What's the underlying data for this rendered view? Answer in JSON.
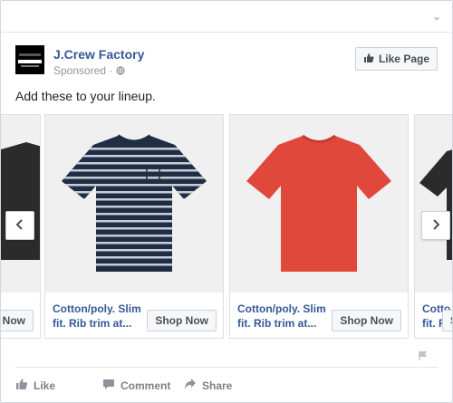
{
  "ad": {
    "page_name": "J.Crew Factory",
    "sponsored": "Sponsored",
    "meta_separator": "·",
    "like_page_label": "Like Page",
    "caption": "Add these to your lineup."
  },
  "carousel": {
    "items": [
      {
        "title": "",
        "cta": "Now",
        "shirt_color": "#2b2b2b"
      },
      {
        "title": "Cotton/poly. Slim fit. Rib trim at...",
        "cta": "Shop Now",
        "shirt_color": "#1f2e45",
        "stripe_color": "#c9ced6"
      },
      {
        "title": "Cotton/poly. Slim fit. Rib trim at...",
        "cta": "Shop Now",
        "shirt_color": "#e0483c"
      },
      {
        "title": "Cotto fit. R",
        "cta": "Sh",
        "shirt_color": "#2b2b2b"
      }
    ],
    "prev_icon": "chevron-left-icon",
    "next_icon": "chevron-right-icon"
  },
  "actions": [
    {
      "label": "Like",
      "icon": "thumbs-up-icon"
    },
    {
      "label": "Comment",
      "icon": "comment-icon"
    },
    {
      "label": "Share",
      "icon": "share-icon"
    }
  ],
  "colors": {
    "link": "#365899",
    "muted": "#90949c",
    "border": "#dddfe2"
  }
}
